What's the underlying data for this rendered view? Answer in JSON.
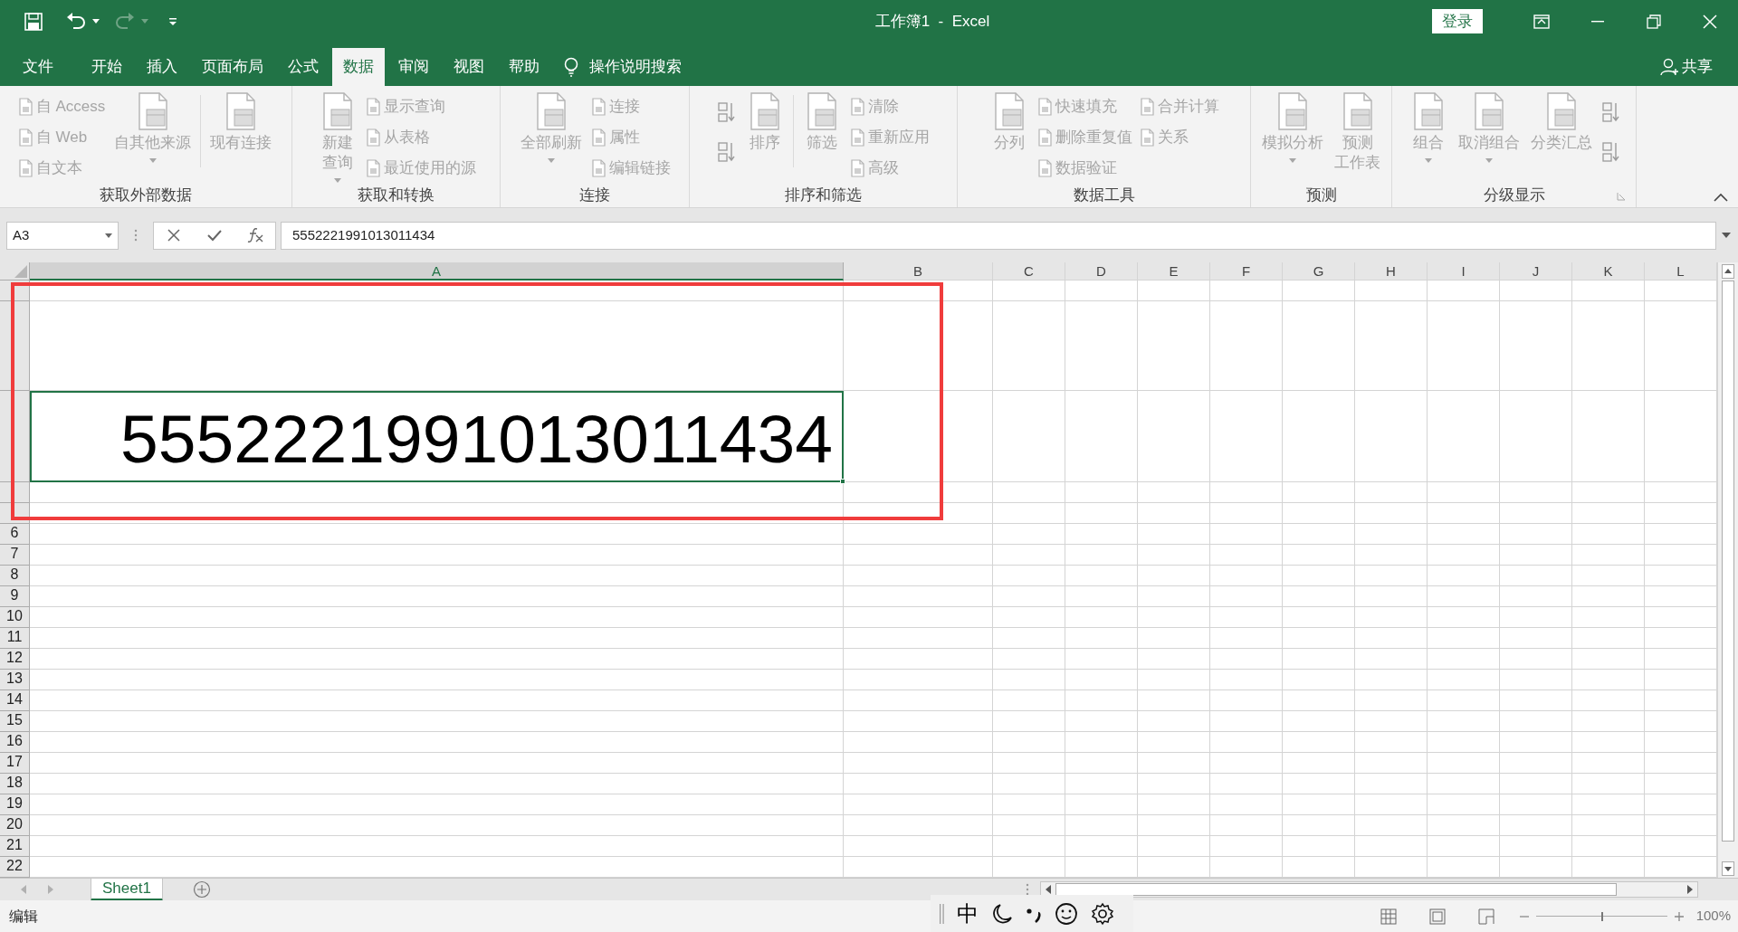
{
  "title_bar": {
    "title": "工作簿1  -  Excel",
    "sign_in": "登录"
  },
  "menu_tabs": [
    {
      "label": "文件",
      "selected": false
    },
    {
      "label": "开始",
      "selected": false
    },
    {
      "label": "插入",
      "selected": false
    },
    {
      "label": "页面布局",
      "selected": false
    },
    {
      "label": "公式",
      "selected": false
    },
    {
      "label": "数据",
      "selected": true
    },
    {
      "label": "审阅",
      "selected": false
    },
    {
      "label": "视图",
      "selected": false
    },
    {
      "label": "帮助",
      "selected": false
    }
  ],
  "tell_me": "操作说明搜索",
  "share": "共享",
  "ribbon": {
    "groups": [
      {
        "label": "获取外部数据",
        "columns": [
          {
            "kind": "small",
            "items": [
              "自 Access",
              "自 Web",
              "自文本"
            ]
          },
          {
            "kind": "large",
            "label": "自其他来源",
            "dropdown": true
          },
          {
            "kind": "divider"
          },
          {
            "kind": "large",
            "label": "现有连接",
            "dropdown": false
          }
        ]
      },
      {
        "label": "获取和转换",
        "columns": [
          {
            "kind": "large",
            "lines": [
              "新建",
              "查询"
            ],
            "dropdown": true
          },
          {
            "kind": "small",
            "items": [
              "显示查询",
              "从表格",
              "最近使用的源"
            ]
          }
        ]
      },
      {
        "label": "连接",
        "columns": [
          {
            "kind": "large",
            "label": "全部刷新",
            "dropdown": true
          },
          {
            "kind": "small",
            "items": [
              "连接",
              "属性",
              "编辑链接"
            ]
          }
        ]
      },
      {
        "label": "排序和筛选",
        "columns": [
          {
            "kind": "icons"
          },
          {
            "kind": "large",
            "label": "排序",
            "dropdown": false
          },
          {
            "kind": "divider"
          },
          {
            "kind": "large",
            "label": "筛选",
            "dropdown": false
          },
          {
            "kind": "small",
            "items": [
              "清除",
              "重新应用",
              "高级"
            ]
          }
        ]
      },
      {
        "label": "数据工具",
        "columns": [
          {
            "kind": "large",
            "label": "分列",
            "dropdown": false
          },
          {
            "kind": "small",
            "items": [
              "快速填充",
              "删除重复值",
              "数据验证"
            ]
          },
          {
            "kind": "small",
            "items": [
              "合并计算",
              "关系"
            ]
          }
        ]
      },
      {
        "label": "预测",
        "columns": [
          {
            "kind": "large",
            "label": "模拟分析",
            "dropdown": true
          },
          {
            "kind": "large",
            "lines": [
              "预测",
              "工作表"
            ],
            "dropdown": false
          }
        ]
      },
      {
        "label": "分级显示",
        "columns": [
          {
            "kind": "large",
            "label": "组合",
            "dropdown": true
          },
          {
            "kind": "large",
            "label": "取消组合",
            "dropdown": true
          },
          {
            "kind": "large",
            "label": "分类汇总",
            "dropdown": false
          },
          {
            "kind": "icons"
          }
        ]
      }
    ]
  },
  "formula_bar": {
    "name_box": "A3",
    "formula": "5552221991013011434"
  },
  "grid": {
    "columns": [
      {
        "label": "A",
        "selected": true
      },
      {
        "label": "B",
        "selected": false
      },
      {
        "label": "C",
        "selected": false
      },
      {
        "label": "D",
        "selected": false
      },
      {
        "label": "E",
        "selected": false
      },
      {
        "label": "F",
        "selected": false
      },
      {
        "label": "G",
        "selected": false
      },
      {
        "label": "H",
        "selected": false
      },
      {
        "label": "I",
        "selected": false
      },
      {
        "label": "J",
        "selected": false
      },
      {
        "label": "K",
        "selected": false
      },
      {
        "label": "L",
        "selected": false
      }
    ],
    "rows": [
      "6",
      "7",
      "8",
      "9",
      "10",
      "11",
      "12",
      "13",
      "14",
      "15",
      "16",
      "17",
      "18",
      "19",
      "20",
      "21",
      "22"
    ],
    "active_cell": {
      "value": "5552221991013011434"
    }
  },
  "sheet_tabs": [
    {
      "label": "Sheet1",
      "selected": true
    }
  ],
  "status_bar": {
    "mode": "编辑",
    "ime": "中",
    "zoom": "100%",
    "zoom_slider": {
      "level": 0.5
    }
  }
}
